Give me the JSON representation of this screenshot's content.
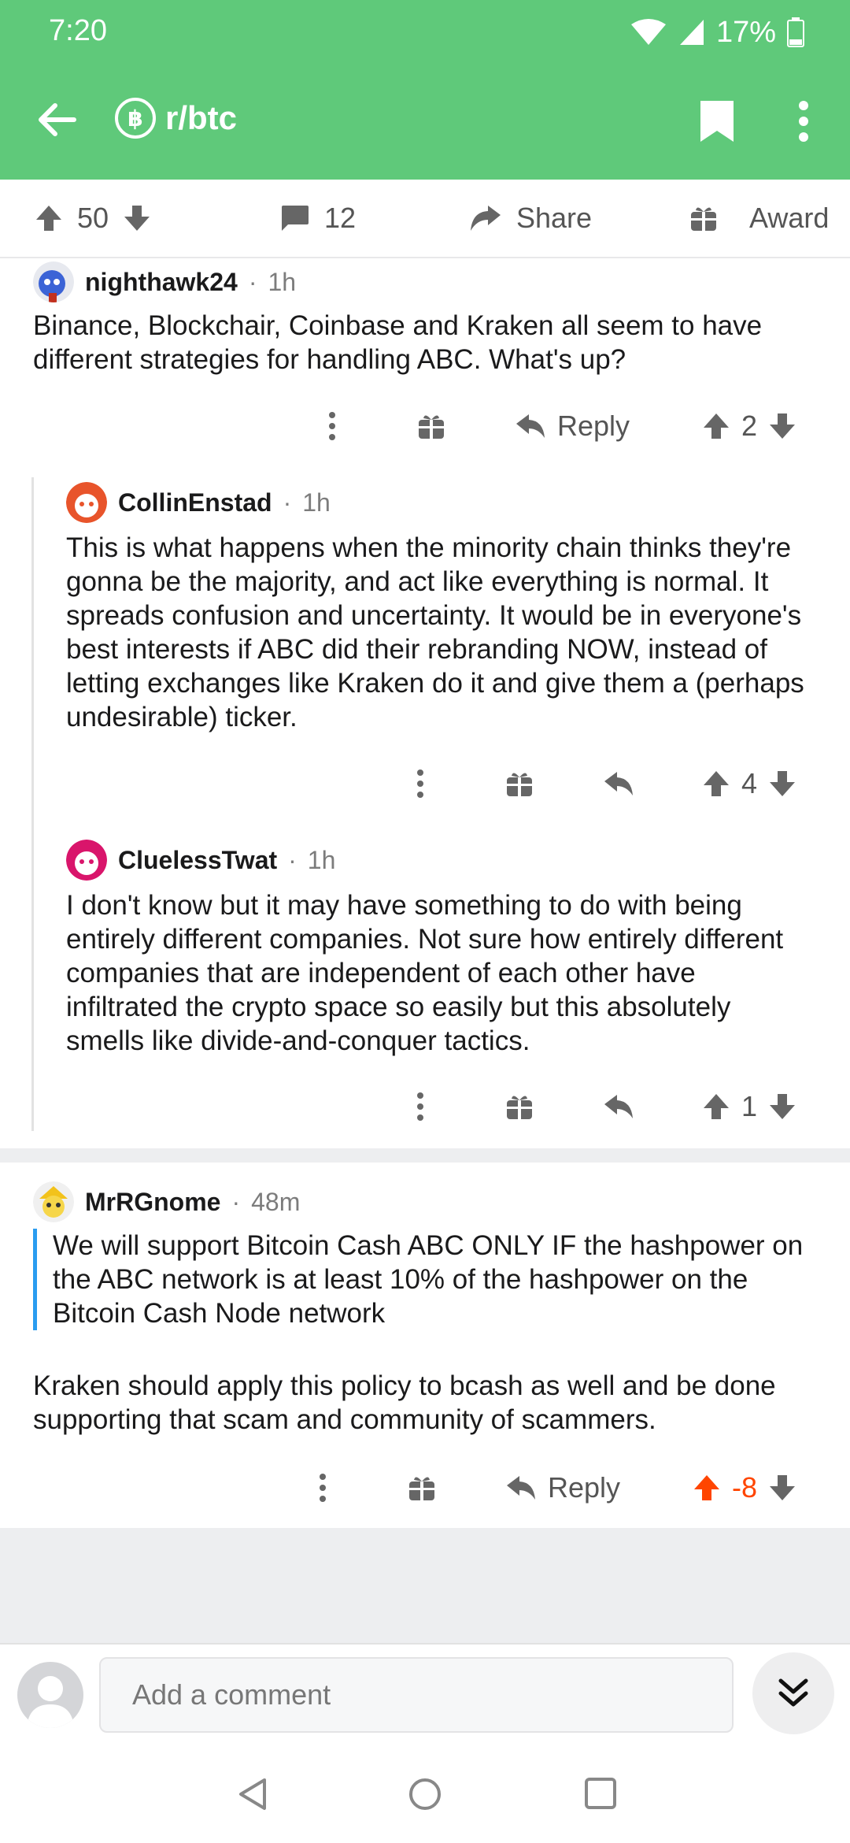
{
  "status_bar": {
    "time": "7:20",
    "battery": "17%"
  },
  "header": {
    "subreddit": "r/btc",
    "sub_icon_glyph": "฿"
  },
  "post_actions": {
    "upvotes": "50",
    "comments": "12",
    "share": "Share",
    "award": "Award"
  },
  "comments": [
    {
      "author": "nighthawk24",
      "age": "1h",
      "body": "Binance, Blockchair, Coinbase and Kraken all seem to have different strategies for handling ABC. What's up?",
      "reply_label": "Reply",
      "score": "2"
    },
    {
      "author": "CollinEnstad",
      "age": "1h",
      "body": "This is what happens when the minority chain thinks they're gonna be the majority, and act like everything is normal. It spreads confusion and uncertainty. It would be in everyone's best interests if ABC did their rebranding NOW, instead of letting exchanges like Kraken do it and give them a (perhaps undesirable) ticker.",
      "score": "4"
    },
    {
      "author": "CluelessTwat",
      "age": "1h",
      "body": "I don't know but it may have something to do with being entirely different companies. Not sure how entirely different companies that are independent of each other have infiltrated the crypto space so easily but this absolutely smells like divide-and-conquer tactics.",
      "score": "1"
    },
    {
      "author": "MrRGnome",
      "age": "48m",
      "quote": "We will support Bitcoin Cash ABC ONLY IF the hashpower on the ABC network is at least 10% of the hashpower on the Bitcoin Cash Node network",
      "body": "Kraken should apply this policy to bcash as well and be done supporting that scam and community of scammers.",
      "reply_label": "Reply",
      "score": "-8"
    }
  ],
  "composer": {
    "placeholder": "Add a comment"
  },
  "colors": {
    "header": "#5fc97a",
    "upvote_active": "#ff4500",
    "quote_bar": "#2a9cf0"
  }
}
